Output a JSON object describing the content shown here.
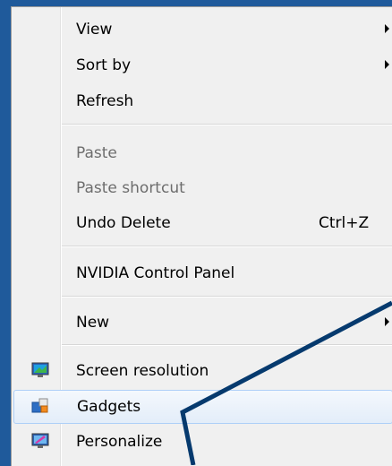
{
  "context_menu": {
    "items": [
      {
        "label": "View",
        "has_submenu": true
      },
      {
        "label": "Sort by",
        "has_submenu": true
      },
      {
        "label": "Refresh"
      },
      {
        "label": "Paste",
        "disabled": true
      },
      {
        "label": "Paste shortcut",
        "disabled": true
      },
      {
        "label": "Undo Delete",
        "shortcut": "Ctrl+Z"
      },
      {
        "label": "NVIDIA Control Panel"
      },
      {
        "label": "New",
        "has_submenu": true
      },
      {
        "label": "Screen resolution",
        "icon": "screen-resolution-icon"
      },
      {
        "label": "Gadgets",
        "icon": "gadgets-icon"
      },
      {
        "label": "Personalize",
        "icon": "personalize-icon"
      }
    ]
  },
  "colors": {
    "menu_background": "#f0f0f0",
    "disabled_text": "#6d6d6d",
    "annotation_stroke": "#003a72",
    "hover_border": "#aecff7"
  }
}
